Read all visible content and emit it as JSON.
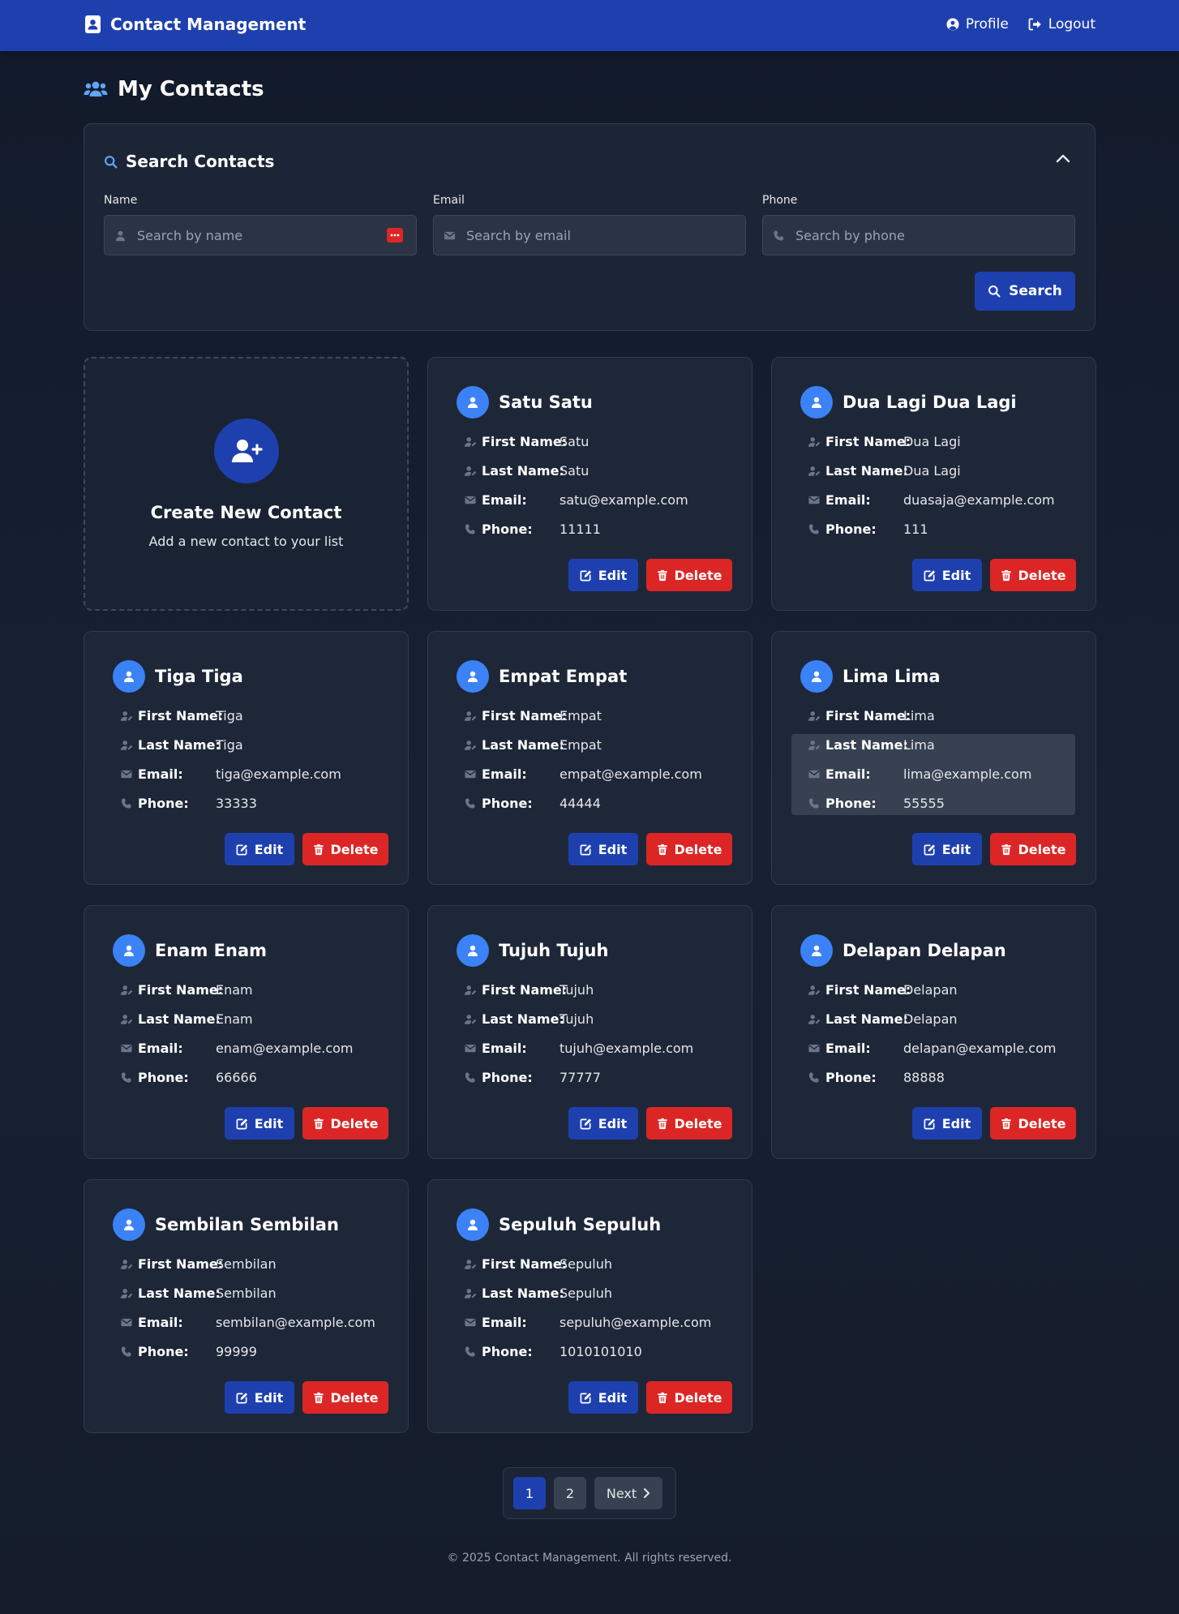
{
  "nav": {
    "brand": "Contact Management",
    "profile_label": "Profile",
    "logout_label": "Logout"
  },
  "page": {
    "title": "My Contacts"
  },
  "search": {
    "title": "Search Contacts",
    "name_label": "Name",
    "name_placeholder": "Search by name",
    "email_label": "Email",
    "email_placeholder": "Search by email",
    "phone_label": "Phone",
    "phone_placeholder": "Search by phone",
    "button_label": "Search"
  },
  "create": {
    "title": "Create New Contact",
    "subtitle": "Add a new contact to your list"
  },
  "labels": {
    "first_name": "First Name:",
    "last_name": "Last Name:",
    "email": "Email:",
    "phone": "Phone:",
    "edit": "Edit",
    "delete": "Delete"
  },
  "contacts": [
    {
      "name": "Satu Satu",
      "first": "Satu",
      "last": "Satu",
      "email": "satu@example.com",
      "phone": "11111"
    },
    {
      "name": "Dua Lagi Dua Lagi",
      "first": "Dua Lagi",
      "last": "Dua Lagi",
      "email": "duasaja@example.com",
      "phone": "111"
    },
    {
      "name": "Tiga Tiga",
      "first": "Tiga",
      "last": "Tiga",
      "email": "tiga@example.com",
      "phone": "33333"
    },
    {
      "name": "Empat Empat",
      "first": "Empat",
      "last": "Empat",
      "email": "empat@example.com",
      "phone": "44444"
    },
    {
      "name": "Lima Lima",
      "first": "Lima",
      "last": "Lima",
      "email": "lima@example.com",
      "phone": "55555"
    },
    {
      "name": "Enam Enam",
      "first": "Enam",
      "last": "Enam",
      "email": "enam@example.com",
      "phone": "66666"
    },
    {
      "name": "Tujuh Tujuh",
      "first": "Tujuh",
      "last": "Tujuh",
      "email": "tujuh@example.com",
      "phone": "77777"
    },
    {
      "name": "Delapan Delapan",
      "first": "Delapan",
      "last": "Delapan",
      "email": "delapan@example.com",
      "phone": "88888"
    },
    {
      "name": "Sembilan Sembilan",
      "first": "Sembilan",
      "last": "Sembilan",
      "email": "sembilan@example.com",
      "phone": "99999"
    },
    {
      "name": "Sepuluh Sepuluh",
      "first": "Sepuluh",
      "last": "Sepuluh",
      "email": "sepuluh@example.com",
      "phone": "1010101010"
    }
  ],
  "pagination": {
    "pages": [
      "1",
      "2"
    ],
    "current": "1",
    "next_label": "Next"
  },
  "footer": "© 2025 Contact Management. All rights reserved.",
  "colors": {
    "navbar": "#1e40af",
    "primary": "#1e40af",
    "danger": "#dc2626",
    "avatar": "#3b82f6"
  }
}
